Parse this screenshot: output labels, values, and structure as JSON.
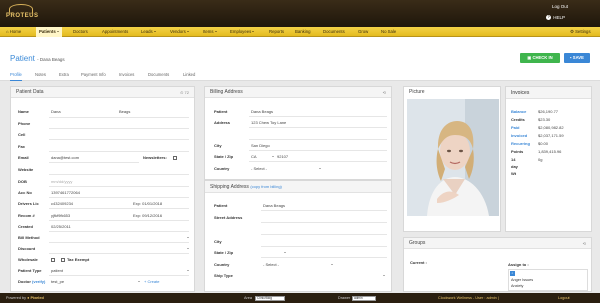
{
  "app": {
    "logo": "PROTEUS",
    "logout": "Log Out",
    "help": "HELP",
    "help_icon": "?"
  },
  "nav": {
    "items": [
      "Home",
      "Patients",
      "Doctors",
      "Appointments",
      "Leads",
      "Vendors",
      "Items",
      "Employees",
      "Reports",
      "Banking",
      "Documents",
      "Grow",
      "No Sale"
    ],
    "settings": "Settings"
  },
  "page": {
    "title": "Patient",
    "subtitle": "- Dana Beags"
  },
  "actions": {
    "checkin": "CHECK IN",
    "save": "SAVE"
  },
  "tabs": [
    "Profile",
    "Notes",
    "Extra",
    "Payment Info",
    "Invoices",
    "Documents",
    "Linked"
  ],
  "patient_data": {
    "heading": "Patient Data",
    "id": "72",
    "name_first": "Dana",
    "name_last": "Beags",
    "phone": "",
    "cell": "",
    "fax": "",
    "email": "dana@test.com",
    "newsletters_label": "Newsletters:",
    "website": "",
    "dob": "mm/dd/yyyy",
    "acc_no": "1397461772064",
    "drivers_lic": "c432409234",
    "drivers_exp": "Exp: 01/01/2018",
    "recom": "yjfkf9fk653",
    "recom_exp": "Exp: 09/12/2016",
    "created": "02/25/2011",
    "bill_method": "",
    "discount": "",
    "tax_exempt_label": "Tax Exempt",
    "patient_type": "patient",
    "doctor_value": "test_pe",
    "doctor_create": "Create",
    "labels": {
      "name": "Name",
      "phone": "Phone",
      "cell": "Cell",
      "fax": "Fax",
      "email": "Email",
      "website": "Website",
      "dob": "DOB",
      "acc": "Acc No",
      "dl": "Drivers Lic",
      "recom": "Recom #",
      "created": "Created",
      "bill": "Bill Method",
      "discount": "Discount",
      "wholesale": "Wholesale",
      "ptype": "Patient Type",
      "doctor": "Doctor",
      "doctor_link": "(verify)"
    }
  },
  "billing": {
    "heading": "Billing Address",
    "patient": "Dana Beags",
    "address": "123 Chew Toy Lane",
    "city": "San Diego",
    "state": "CA",
    "zip": "92107",
    "country": "- Select -",
    "labels": {
      "patient": "Patient",
      "address": "Address",
      "city": "City",
      "statezip": "State / Zip",
      "country": "Country"
    }
  },
  "shipping": {
    "heading": "Shipping Address",
    "copy_link": "(copy from billing)",
    "patient": "Dana Beags",
    "country": "- Select -",
    "labels": {
      "patient": "Patient",
      "street": "Street Address",
      "city": "City",
      "statezip": "State / Zip",
      "country": "Country",
      "shiptype": "Ship Type"
    }
  },
  "picture": {
    "heading": "Picture"
  },
  "invoices": {
    "heading": "Invoices",
    "rows": [
      {
        "k": "Balance",
        "v": "$26,190.77"
      },
      {
        "k": "Credits",
        "v": "$23.30"
      },
      {
        "k": "Paid",
        "v": "$2,080,982.82"
      },
      {
        "k": "Invoiced",
        "v": "$2,037,171.59"
      },
      {
        "k": "Recurring",
        "v": "$0.00"
      },
      {
        "k": "Points",
        "v": "1,839,415.96"
      },
      {
        "k": "14 day Wt",
        "v": "0g"
      }
    ]
  },
  "groups": {
    "heading": "Groups",
    "current": "Current :",
    "assign": "Assign to :",
    "assign_items": [
      "Anger Issues",
      "Anxiety"
    ]
  },
  "footer": {
    "powered": "Powered by",
    "brand": "Pixeled",
    "area_label": "Area",
    "area_value": "Clinic/Bldg",
    "drawer_label": "Drawer",
    "drawer_value": "admin",
    "status": "Clockwork Wellness - User : admin |",
    "logout": "Logout"
  },
  "colors": {
    "nav": "#ebc62c",
    "primary": "#3a87d6",
    "success": "#3fb54d",
    "header": "#2a1e10"
  }
}
